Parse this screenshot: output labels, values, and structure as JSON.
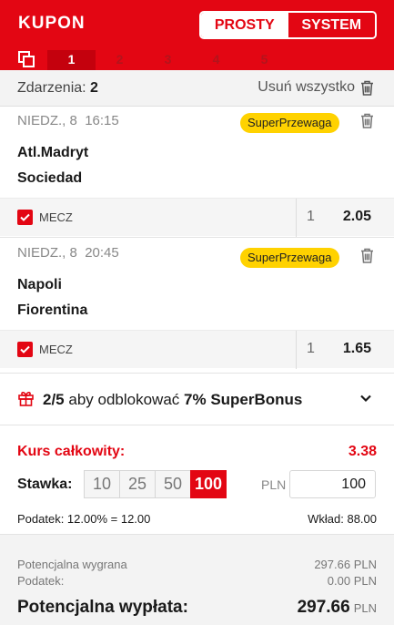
{
  "header": {
    "title": "KUPON",
    "mode_simple": "PROSTY",
    "mode_system": "SYSTEM",
    "tabs": [
      "1",
      "2",
      "3",
      "4",
      "5"
    ],
    "active_tab": "1"
  },
  "events": {
    "label": "Zdarzenia:",
    "count": "2",
    "remove_all": "Usuń wszystko"
  },
  "bets": [
    {
      "date": "NIEDZ., 8",
      "time": "16:15",
      "badge": "SuperPrzewaga",
      "home": "Atl.Madryt",
      "away": "Sociedad",
      "market": "MECZ",
      "outcome": "1",
      "odds": "2.05"
    },
    {
      "date": "NIEDZ., 8",
      "time": "20:45",
      "badge": "SuperPrzewaga",
      "home": "Napoli",
      "away": "Fiorentina",
      "market": "MECZ",
      "outcome": "1",
      "odds": "1.65"
    }
  ],
  "bonus": {
    "progress": "2/5",
    "middle": "aby odblokować",
    "reward": "7% SuperBonus"
  },
  "stake": {
    "kurs_label": "Kurs całkowity:",
    "kurs_value": "3.38",
    "stawka_label": "Stawka:",
    "chips": [
      "10",
      "25",
      "50",
      "100"
    ],
    "active_chip": "100",
    "currency": "PLN",
    "input_value": "100",
    "tax_text": "Podatek: 12.00% = 12.00",
    "stake_text": "Wkład: 88.00"
  },
  "summary": {
    "potential_win_label": "Potencjalna wygrana",
    "potential_win_value": "297.66",
    "tax_label": "Podatek:",
    "tax_value": "0.00",
    "currency": "PLN",
    "payout_label": "Potencjalna wypłata:",
    "payout_value": "297.66"
  },
  "colors": {
    "brand_red": "#e30613",
    "badge_yellow": "#ffd200"
  }
}
